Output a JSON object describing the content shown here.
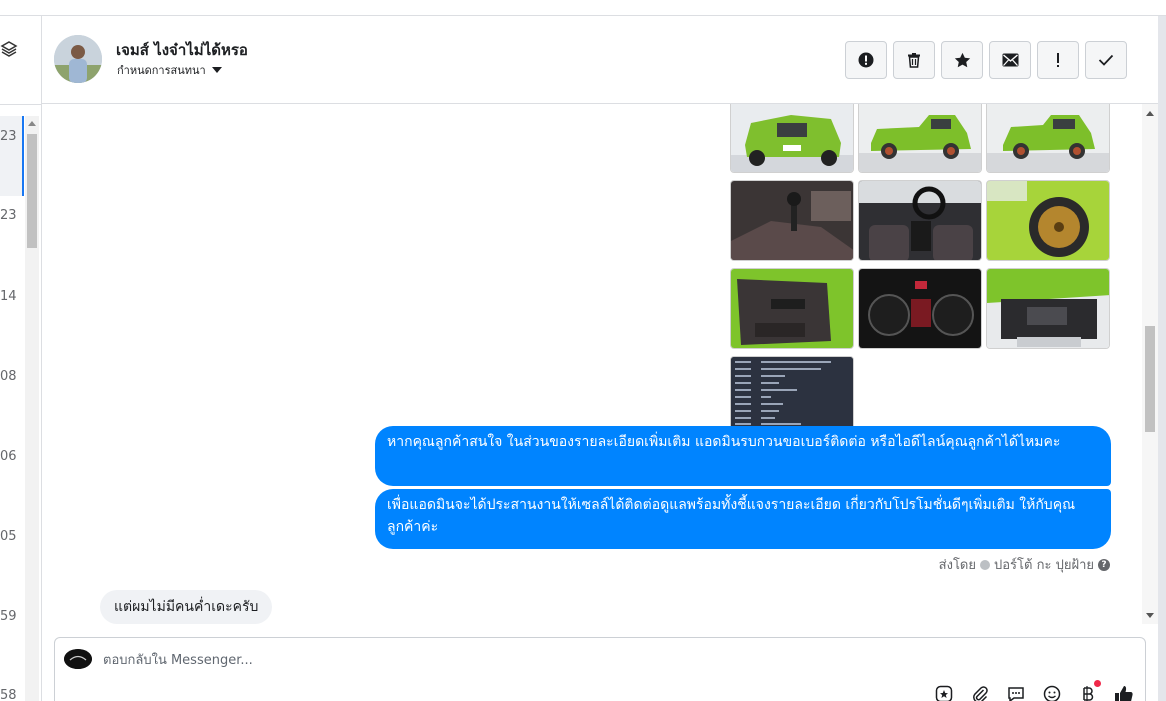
{
  "left_list": {
    "numbers": [
      "23",
      "23",
      "14",
      "08",
      "06",
      "05",
      "59",
      "58"
    ]
  },
  "header": {
    "contact_name": "เจมส์ ไงจ๋าไม่ได้หรอ",
    "assign_label": "กำหนดการสนทนา",
    "actions": [
      {
        "name": "report-spam-button",
        "icon": "alert-circle-icon"
      },
      {
        "name": "delete-button",
        "icon": "trash-icon"
      },
      {
        "name": "star-button",
        "icon": "star-icon"
      },
      {
        "name": "mark-unread-button",
        "icon": "envelope-icon"
      },
      {
        "name": "follow-up-button",
        "icon": "exclamation-icon"
      },
      {
        "name": "mark-done-button",
        "icon": "check-icon"
      }
    ]
  },
  "conversation": {
    "photo_count": 10,
    "messages_out": [
      "หากคุณลูกค้าสนใจ ในส่วนของรายละเอียดเพิ่มเติม แอดมินรบกวนขอเบอร์ติดต่อ หรือไอดีไลน์คุณลูกค้าได้ไหมคะ",
      "เพื่อแอดมินจะได้ประสานงานให้เซลล์ได้ติดต่อดูแลพร้อมทั้งชี้แจงรายละเอียด เกี่ยวกับโปรโมชั่นดีๆเพิ่มเติม ให้กับคุณลูกค้าค่ะ"
    ],
    "sent_by_prefix": "ส่งโดย",
    "sent_by_name": "ปอร์โต้ กะ ปุยฝ้าย",
    "message_in": "แต่ผมไม่มีคนค่ำเดะครับ"
  },
  "composer": {
    "placeholder": "ตอบกลับใน Messenger...",
    "tools": [
      "sticker-icon",
      "attachment-icon",
      "saved-reply-icon",
      "emoji-icon",
      "payment-icon",
      "like-icon"
    ]
  },
  "colors": {
    "accent": "#0084ff",
    "incoming_bubble": "#f0f2f5",
    "notification": "#f02849"
  }
}
